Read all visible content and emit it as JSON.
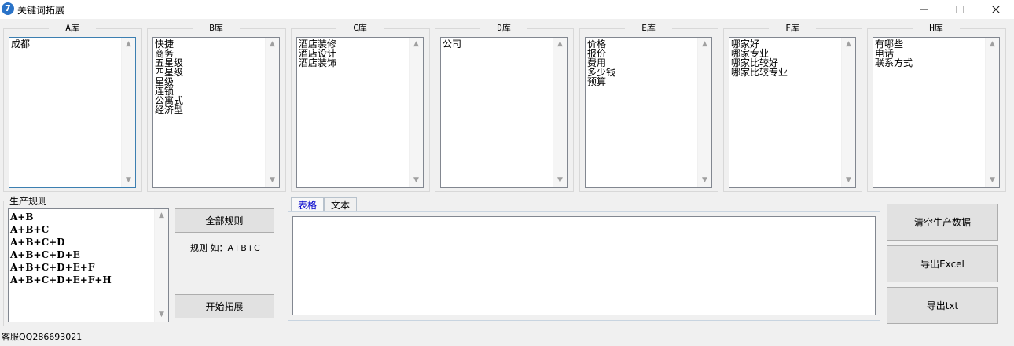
{
  "window": {
    "title": "关键词拓展",
    "icon_text": "7"
  },
  "libraries": [
    {
      "label": "A库",
      "items": [
        "成都"
      ]
    },
    {
      "label": "B库",
      "items": [
        "快捷",
        "商务",
        "五星级",
        "四星级",
        "星级",
        "连锁",
        "公寓式",
        "经济型"
      ]
    },
    {
      "label": "C库",
      "items": [
        "酒店装修",
        "酒店设计",
        "酒店装饰"
      ]
    },
    {
      "label": "D库",
      "items": [
        "公司"
      ]
    },
    {
      "label": "E库",
      "items": [
        "价格",
        "报价",
        "费用",
        "多少钱",
        "预算"
      ]
    },
    {
      "label": "F库",
      "items": [
        "哪家好",
        "哪家专业",
        "哪家比较好",
        "哪家比较专业"
      ]
    },
    {
      "label": "H库",
      "items": [
        "有哪些",
        "电话",
        "联系方式"
      ]
    }
  ],
  "rules": {
    "group_label": "生产规则",
    "items": [
      "A+B",
      "A+B+C",
      "A+B+C+D",
      "A+B+C+D+E",
      "A+B+C+D+E+F",
      "A+B+C+D+E+F+H"
    ],
    "all_rules_button": "全部规则",
    "hint": "规则 如：A+B+C",
    "start_button": "开始拓展"
  },
  "tabs": [
    {
      "label": "表格",
      "active": true
    },
    {
      "label": "文本",
      "active": false
    }
  ],
  "actions": {
    "clear": "清空生产数据",
    "export_excel": "导出Excel",
    "export_txt": "导出txt"
  },
  "status": "客服QQ286693021"
}
